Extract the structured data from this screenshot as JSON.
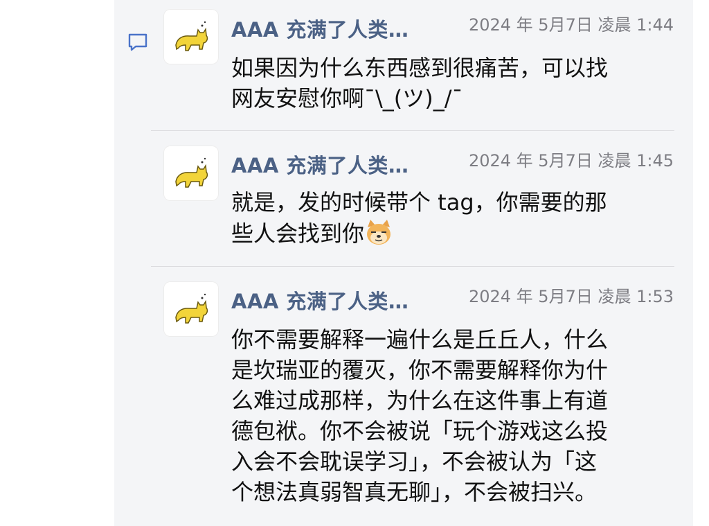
{
  "messages": [
    {
      "author": "AAA 充满了人类…",
      "time": "2024 年 5月7日 凌晨 1:44",
      "lines": [
        "如果因为什么东西感到很痛苦，可以找",
        "网友安慰你啊¯\\_(ツ)_/¯"
      ]
    },
    {
      "author": "AAA 充满了人类…",
      "time": "2024 年 5月7日 凌晨 1:45",
      "lines": [
        "就是，发的时候带个 tag，你需要的那",
        "些人会找到你"
      ],
      "emoji": "doge-emoji"
    },
    {
      "author": "AAA 充满了人类…",
      "time": "2024 年 5月7日 凌晨 1:53",
      "lines": [
        "你不需要解释一遍什么是丘丘人，什么",
        "是坎瑞亚的覆灭，你不需要解释你为什",
        "么难过成那样，为什么在这件事上有道",
        "德包袱。你不会被说「玩个游戏这么投",
        "入会不会耽误学习」，不会被认为「这",
        "个想法真弱智真无聊」，不会被扫兴。"
      ]
    }
  ],
  "icons": {
    "reply": "comment-icon",
    "avatar": "cat-avatar-icon"
  },
  "colors": {
    "name": "#4b6185",
    "time": "#7d7d83",
    "panel": "#f4f5f7",
    "icon": "#4a73c9",
    "cat": "#f2d43a"
  }
}
